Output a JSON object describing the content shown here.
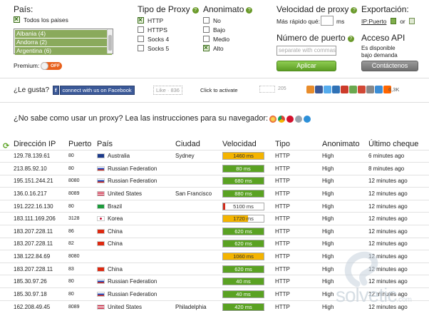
{
  "filters": {
    "pais": {
      "label": "País:",
      "all_label": "Todos los paises",
      "all_checked": true,
      "options": [
        "Albania (4)",
        "Andorra (2)",
        "Argentina (6)"
      ]
    },
    "premium": {
      "label": "Premium:",
      "state": "OFF"
    },
    "tipo": {
      "label": "Tipo de Proxy",
      "options": [
        {
          "label": "HTTP",
          "checked": true
        },
        {
          "label": "HTTPS",
          "checked": false
        },
        {
          "label": "Socks 4",
          "checked": false
        },
        {
          "label": "Socks 5",
          "checked": false
        }
      ]
    },
    "anonimato": {
      "label": "Anonimato",
      "options": [
        {
          "label": "No",
          "checked": false
        },
        {
          "label": "Bajo",
          "checked": false
        },
        {
          "label": "Medio",
          "checked": false
        },
        {
          "label": "Alto",
          "checked": true
        }
      ]
    },
    "velocidad": {
      "label": "Velocidad de proxy",
      "faster_label": "Más rápido qué:",
      "unit": "ms"
    },
    "puerto": {
      "label": "Número de puerto",
      "placeholder": "separate with commas"
    },
    "apply_label": "Aplicar",
    "export": {
      "label": "Exportación:",
      "link": "IP:Puerto",
      "or": "or"
    },
    "api": {
      "label": "Acceso API",
      "line1": "Es disponible",
      "line2": "bajo demanda",
      "contact_label": "Contáctenos"
    }
  },
  "social": {
    "like_label": "¿Le gusta?",
    "facebook_label": "connect with us on Facebook",
    "fb_like": "Like",
    "fb_count": "836",
    "activate": "Click to activate",
    "tw_count": "205",
    "share_count": "6,3K"
  },
  "instructions": "¿No sabe como usar un proxy? Lea las instrucciones para su navegador:",
  "table": {
    "headers": [
      "Dirección IP",
      "Puerto",
      "País",
      "Ciudad",
      "Velocidad",
      "Tipo",
      "Anonimato",
      "Último cheque"
    ],
    "rows": [
      {
        "ip": "129.78.139.61",
        "port": "80",
        "country": "Australia",
        "flag": "au",
        "city": "Sydney",
        "speed": "1460 ms",
        "speed_frac": 1.0,
        "speed_color": "#f4b400",
        "type": "HTTP",
        "anon": "High",
        "check": "6 minutes ago"
      },
      {
        "ip": "213.85.92.10",
        "port": "80",
        "country": "Russian Federation",
        "flag": "ru",
        "city": "",
        "speed": "80 ms",
        "speed_frac": 1.0,
        "speed_color": "#5aa222",
        "type": "HTTP",
        "anon": "High",
        "check": "8 minutes ago"
      },
      {
        "ip": "195.151.244.21",
        "port": "8080",
        "country": "Russian Federation",
        "flag": "ru",
        "city": "",
        "speed": "680 ms",
        "speed_frac": 1.0,
        "speed_color": "#5aa222",
        "type": "HTTP",
        "anon": "High",
        "check": "12 minutes ago"
      },
      {
        "ip": "136.0.16.217",
        "port": "8089",
        "country": "United States",
        "flag": "us",
        "city": "San Francisco",
        "speed": "880 ms",
        "speed_frac": 1.0,
        "speed_color": "#5aa222",
        "type": "HTTP",
        "anon": "High",
        "check": "12 minutes ago"
      },
      {
        "ip": "191.222.16.130",
        "port": "80",
        "country": "Brazil",
        "flag": "br",
        "city": "",
        "speed": "5100 ms",
        "speed_frac": 0.05,
        "speed_color": "#d12a1a",
        "type": "HTTP",
        "anon": "High",
        "check": "12 minutes ago"
      },
      {
        "ip": "183.111.169.206",
        "port": "3128",
        "country": "Korea",
        "flag": "kr",
        "city": "",
        "speed": "1720 ms",
        "speed_frac": 0.62,
        "speed_color": "#f4b400",
        "type": "HTTP",
        "anon": "High",
        "check": "12 minutes ago"
      },
      {
        "ip": "183.207.228.11",
        "port": "86",
        "country": "China",
        "flag": "cn",
        "city": "",
        "speed": "620 ms",
        "speed_frac": 1.0,
        "speed_color": "#5aa222",
        "type": "HTTP",
        "anon": "High",
        "check": "12 minutes ago"
      },
      {
        "ip": "183.207.228.11",
        "port": "82",
        "country": "China",
        "flag": "cn",
        "city": "",
        "speed": "620 ms",
        "speed_frac": 1.0,
        "speed_color": "#5aa222",
        "type": "HTTP",
        "anon": "High",
        "check": "12 minutes ago"
      },
      {
        "ip": "138.122.84.69",
        "port": "8080",
        "country": "",
        "flag": "",
        "city": "",
        "speed": "1060 ms",
        "speed_frac": 1.0,
        "speed_color": "#f4b400",
        "type": "HTTP",
        "anon": "High",
        "check": "12 minutes ago"
      },
      {
        "ip": "183.207.228.11",
        "port": "83",
        "country": "China",
        "flag": "cn",
        "city": "",
        "speed": "620 ms",
        "speed_frac": 1.0,
        "speed_color": "#5aa222",
        "type": "HTTP",
        "anon": "High",
        "check": "12 minutes ago"
      },
      {
        "ip": "185.30.97.26",
        "port": "80",
        "country": "Russian Federation",
        "flag": "ru",
        "city": "",
        "speed": "40 ms",
        "speed_frac": 1.0,
        "speed_color": "#5aa222",
        "type": "HTTP",
        "anon": "High",
        "check": "12 minutes ago"
      },
      {
        "ip": "185.30.97.18",
        "port": "80",
        "country": "Russian Federation",
        "flag": "ru",
        "city": "",
        "speed": "40 ms",
        "speed_frac": 1.0,
        "speed_color": "#5aa222",
        "type": "HTTP",
        "anon": "High",
        "check": "12 minutes ago"
      },
      {
        "ip": "162.208.49.45",
        "port": "8089",
        "country": "United States",
        "flag": "us",
        "city": "Philadelphia",
        "speed": "420 ms",
        "speed_frac": 1.0,
        "speed_color": "#5aa222",
        "type": "HTTP",
        "anon": "High",
        "check": "12 minutes ago"
      }
    ]
  },
  "watermark": {
    "name": "solvetic",
    "domain": ".com"
  },
  "colors": {
    "accent_green": "#5aa222",
    "warn_yellow": "#f4b400",
    "bad_red": "#d12a1a",
    "toggle_orange": "#e8611c"
  }
}
